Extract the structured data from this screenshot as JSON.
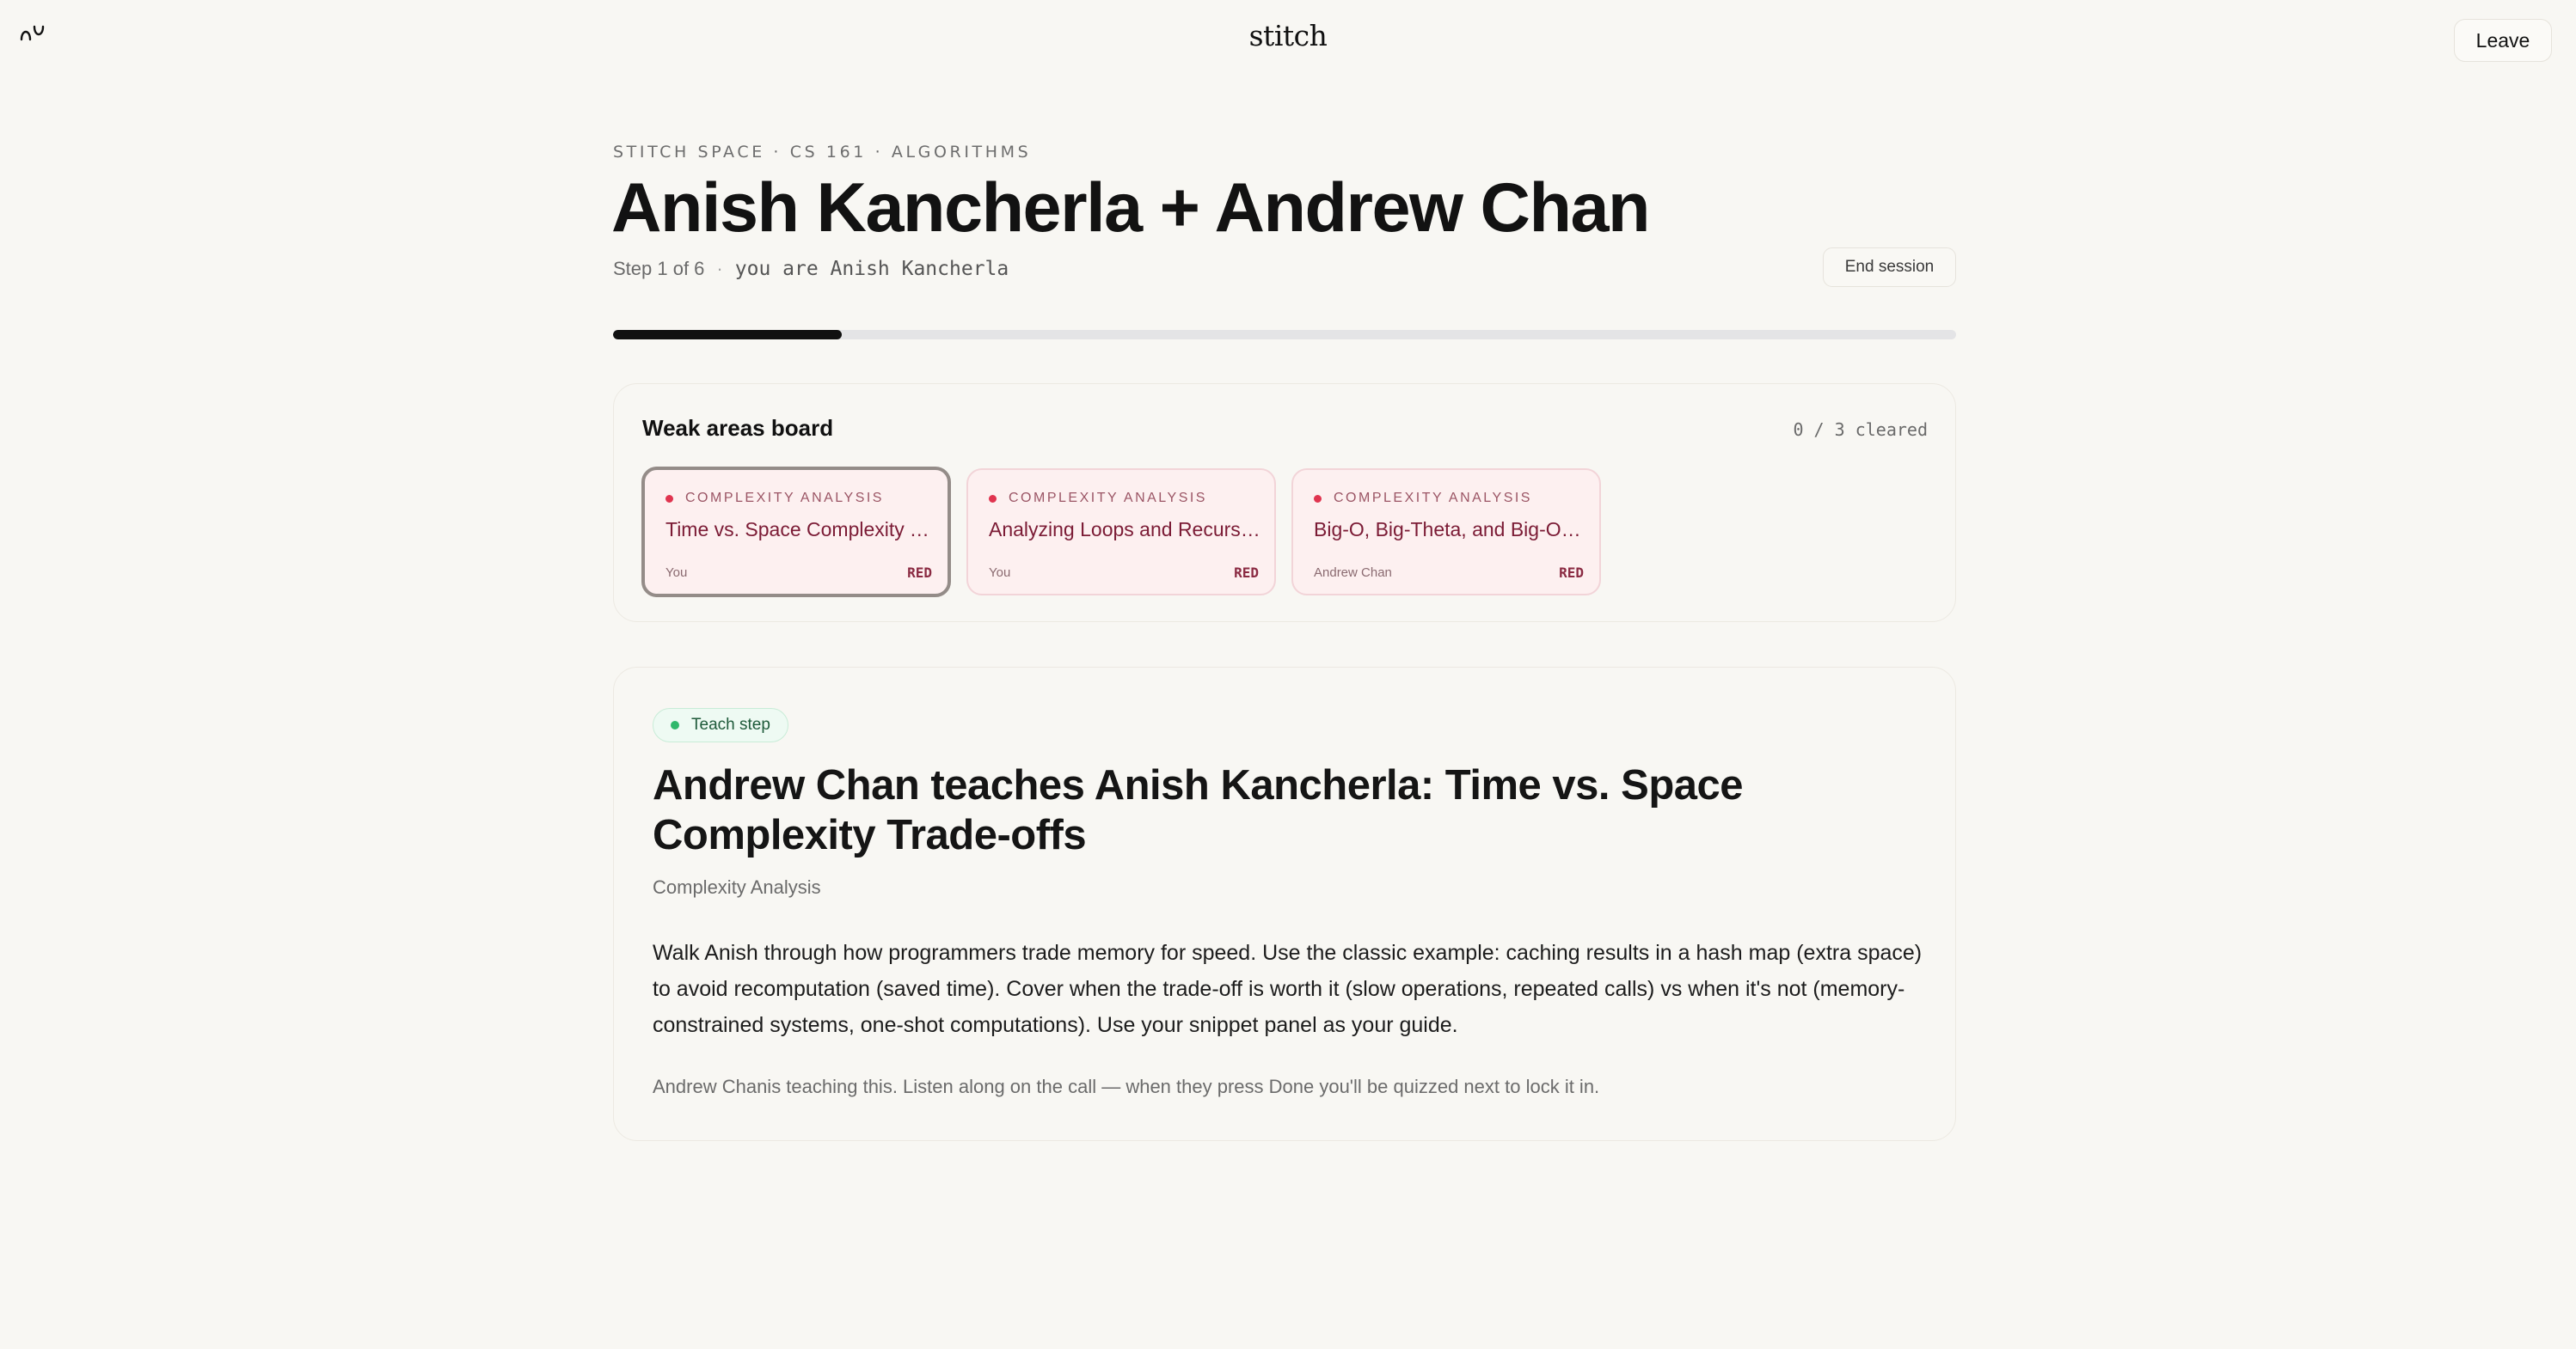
{
  "header": {
    "brand": "stitch",
    "leave_label": "Leave"
  },
  "session": {
    "eyebrow": "STITCH SPACE · CS 161 · ALGORITHMS",
    "title": "Anish Kancherla + Andrew Chan",
    "step_text": "Step 1 of 6",
    "separator": "·",
    "you_are": "you are Anish Kancherla",
    "end_label": "End session",
    "progress_fraction": 0.17
  },
  "board": {
    "title": "Weak areas board",
    "count": "0 / 3 cleared",
    "cards": [
      {
        "category": "COMPLEXITY ANALYSIS",
        "title": "Time vs. Space Complexity Tr...",
        "owner": "You",
        "status": "RED",
        "selected": true
      },
      {
        "category": "COMPLEXITY ANALYSIS",
        "title": "Analyzing Loops and Recursiv...",
        "owner": "You",
        "status": "RED",
        "selected": false
      },
      {
        "category": "COMPLEXITY ANALYSIS",
        "title": "Big-O, Big-Theta, and Big-Om...",
        "owner": "Andrew Chan",
        "status": "RED",
        "selected": false
      }
    ]
  },
  "teach": {
    "pill": "Teach step",
    "title": "Andrew Chan teaches Anish Kancherla: Time vs. Space Complexity Trade-offs",
    "subtitle": "Complexity Analysis",
    "body": "Walk Anish through how programmers trade memory for speed. Use the classic example: caching results in a hash map (extra space) to avoid recomputation (saved time). Cover when the trade-off is worth it (slow operations, repeated calls) vs when it's not (memory-constrained systems, one-shot computations). Use your snippet panel as your guide.",
    "note": "Andrew Chanis teaching this. Listen along on the call — when they press Done you'll be quizzed next to lock it in."
  },
  "colors": {
    "background": "#f8f7f3",
    "progress_fill": "#111111",
    "card_bg": "#fdf0f0",
    "status_red": "#e0344f",
    "teach_green": "#2fb86b"
  },
  "icons": {
    "logo": "stitch-logo-icon"
  }
}
